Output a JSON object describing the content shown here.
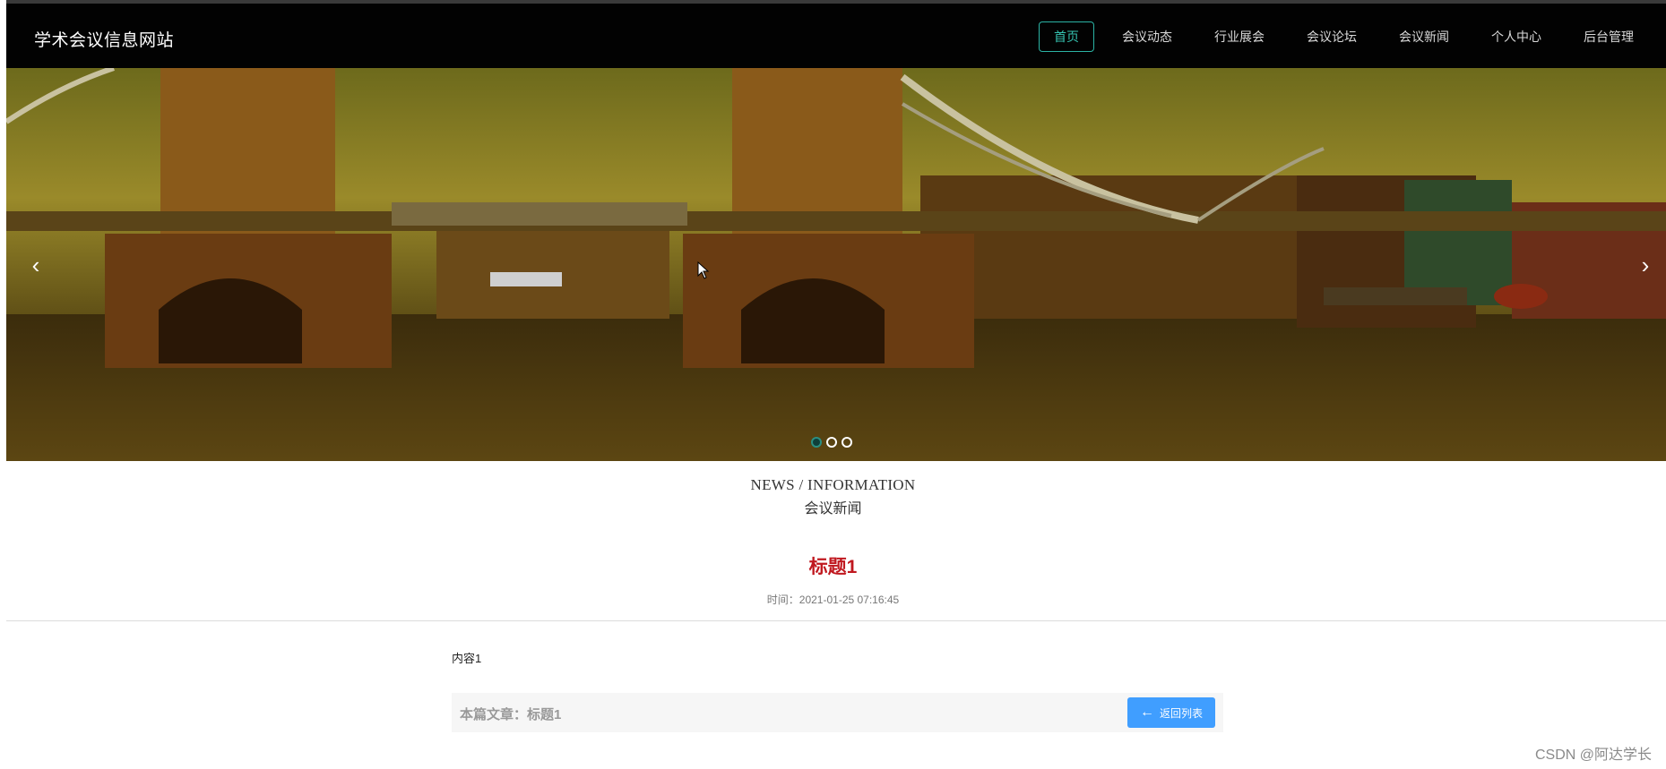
{
  "header": {
    "site_title": "学术会议信息网站",
    "nav": [
      {
        "label": "首页",
        "active": true
      },
      {
        "label": "会议动态",
        "active": false
      },
      {
        "label": "行业展会",
        "active": false
      },
      {
        "label": "会议论坛",
        "active": false
      },
      {
        "label": "会议新闻",
        "active": false
      },
      {
        "label": "个人中心",
        "active": false
      },
      {
        "label": "后台管理",
        "active": false
      }
    ]
  },
  "banner": {
    "prev_icon": "chevron-left-icon",
    "next_icon": "chevron-right-icon",
    "slide_count": 3,
    "active_slide": 1
  },
  "section": {
    "title_en": "NEWS / INFORMATION",
    "title_cn": "会议新闻"
  },
  "article": {
    "title": "标题1",
    "time": "时间：2021-01-25 07:16:45",
    "content": "内容1",
    "current_label": "本篇文章：标题1",
    "back_label": "返回列表",
    "back_icon": "arrow-left-icon"
  },
  "watermark": "CSDN @阿达学长",
  "colors": {
    "header_bg": "#020202",
    "nav_active": "#35c2b0",
    "title_red": "#c0181f",
    "button_blue": "#409eff"
  }
}
